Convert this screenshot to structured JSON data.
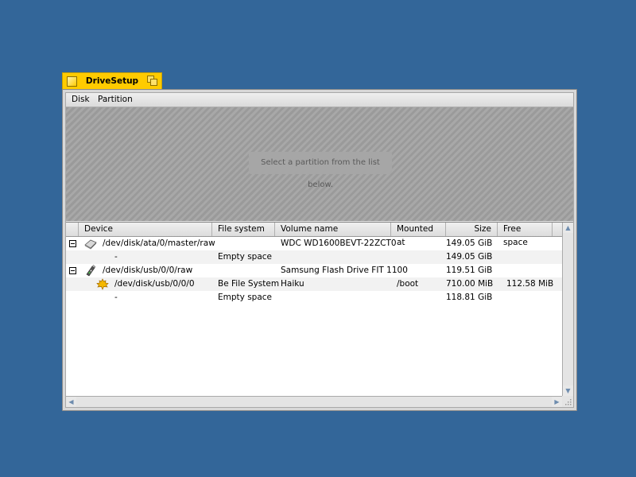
{
  "window": {
    "title": "DriveSetup",
    "accent": "#ffcb00",
    "desktop_color": "#336699"
  },
  "menu": [
    {
      "label": "Disk"
    },
    {
      "label": "Partition"
    }
  ],
  "disk_view": {
    "hint": "Select a partition from the list below."
  },
  "columns": [
    {
      "label": "Device"
    },
    {
      "label": "File system"
    },
    {
      "label": "Volume name"
    },
    {
      "label": "Mounted at"
    },
    {
      "label": "Size"
    },
    {
      "label": "Free space"
    }
  ],
  "rows": [
    {
      "expander": "collapse",
      "icon": "harddisk-icon",
      "device": "/dev/disk/ata/0/master/raw",
      "filesystem": "",
      "volume": "WDC WD1600BEVT-22ZCT0",
      "mounted": "",
      "size": "149.05 GiB",
      "free": ""
    },
    {
      "expander": "",
      "icon": "",
      "device": "-",
      "filesystem": "Empty space",
      "volume": "",
      "mounted": "",
      "size": "149.05 GiB",
      "free": ""
    },
    {
      "expander": "collapse",
      "icon": "usb-drive-icon",
      "device": "/dev/disk/usb/0/0/raw",
      "filesystem": "",
      "volume": "Samsung Flash Drive FIT 1100",
      "mounted": "",
      "size": "119.51 GiB",
      "free": ""
    },
    {
      "expander": "",
      "icon": "haiku-leaf-icon",
      "device": "/dev/disk/usb/0/0/0",
      "filesystem": "Be File System",
      "volume": "Haiku",
      "mounted": "/boot",
      "size": "710.00 MiB",
      "free": "112.58 MiB"
    },
    {
      "expander": "",
      "icon": "",
      "device": "-",
      "filesystem": "Empty space",
      "volume": "",
      "mounted": "",
      "size": "118.81 GiB",
      "free": ""
    }
  ]
}
